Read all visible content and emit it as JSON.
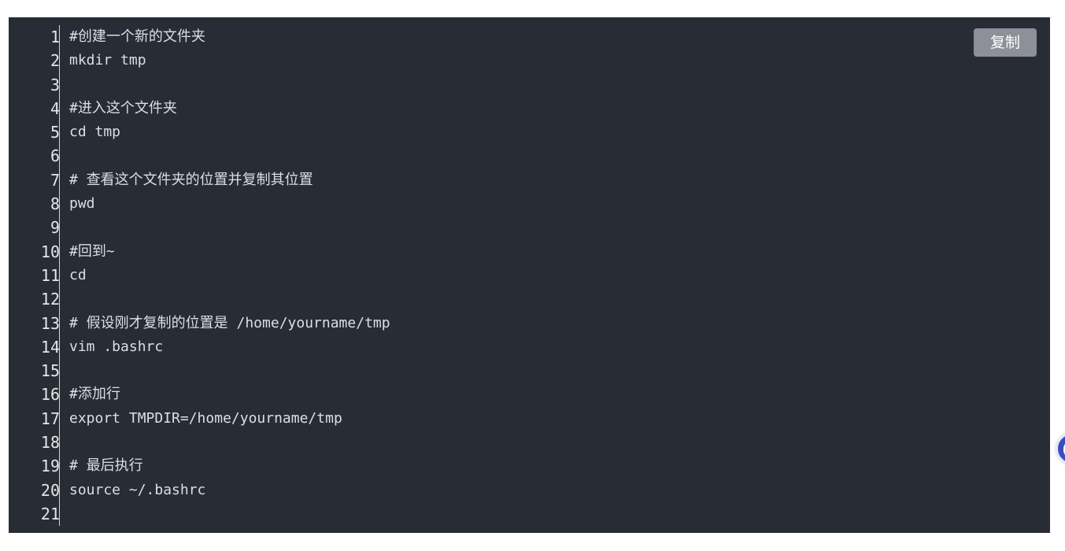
{
  "code_block": {
    "copy_label": "复制",
    "line_numbers": [
      "1",
      "2",
      "3",
      "4",
      "5",
      "6",
      "7",
      "8",
      "9",
      "10",
      "11",
      "12",
      "13",
      "14",
      "15",
      "16",
      "17",
      "18",
      "19",
      "20",
      "21"
    ],
    "lines": [
      "#创建一个新的文件夹",
      "mkdir tmp",
      "",
      "#进入这个文件夹",
      "cd tmp",
      "",
      "# 查看这个文件夹的位置并复制其位置",
      "pwd",
      "",
      "#回到~",
      "cd",
      "",
      "# 假设刚才复制的位置是 /home/yourname/tmp",
      "vim .bashrc",
      "",
      "#添加行",
      "export TMPDIR=/home/yourname/tmp",
      "",
      "# 最后执行",
      "source ~/.bashrc",
      ""
    ]
  },
  "colors": {
    "code_background": "#282c34",
    "code_text": "#dcdfe4",
    "copy_button_bg": "#8d8f99"
  },
  "floating_widget": {
    "icon": "assistant-icon"
  }
}
